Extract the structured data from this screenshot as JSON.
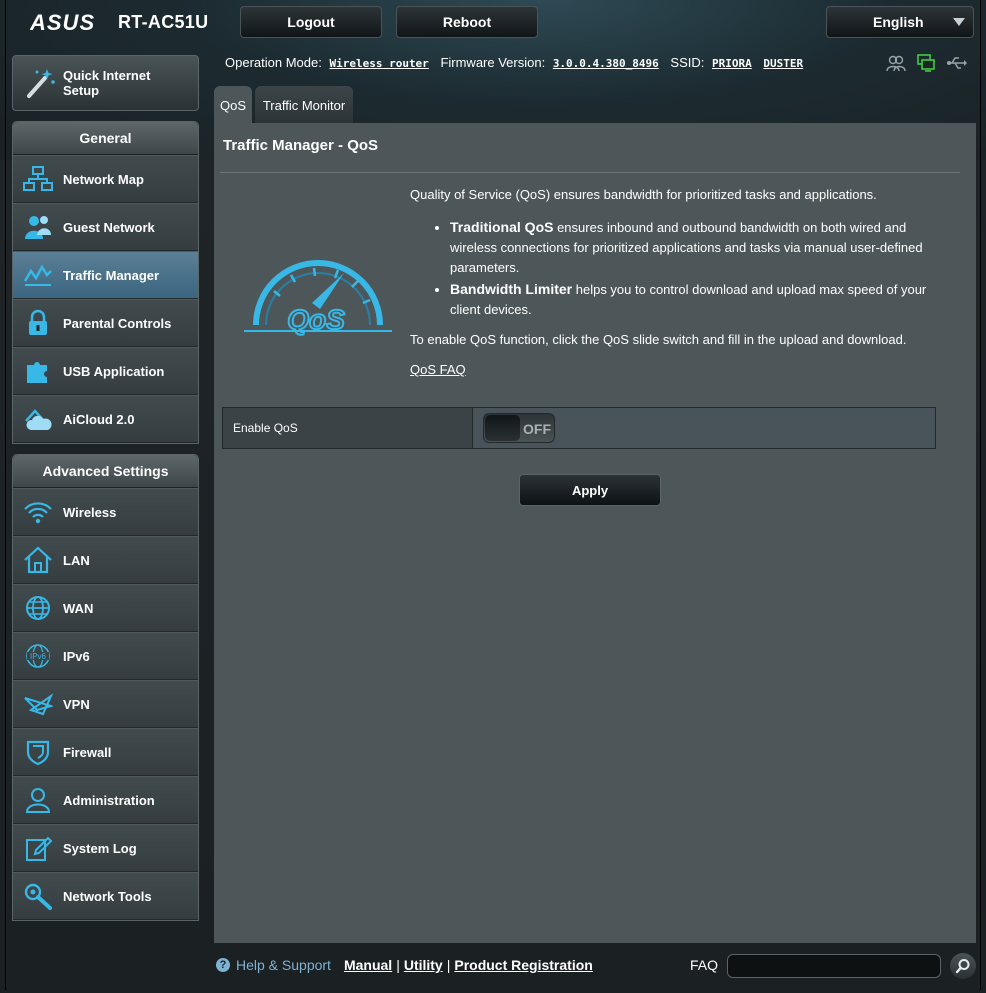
{
  "header": {
    "brand": "ASUS",
    "model": "RT-AC51U",
    "logout_label": "Logout",
    "reboot_label": "Reboot",
    "language": "English"
  },
  "status": {
    "operation_mode_label": "Operation Mode:",
    "operation_mode_value": "Wireless router",
    "firmware_label": "Firmware Version:",
    "firmware_value": "3.0.0.4.380_8496",
    "ssid_label": "SSID:",
    "ssid_1": "PRIORA",
    "ssid_2": "DUSTER",
    "icons": [
      "clients-icon",
      "network-status-icon",
      "usb-icon"
    ]
  },
  "sidebar": {
    "quick_setup_line1": "Quick Internet",
    "quick_setup_line2": "Setup",
    "general_title": "General",
    "general_items": [
      {
        "label": "Network Map",
        "icon": "network-map-icon"
      },
      {
        "label": "Guest Network",
        "icon": "guest-network-icon"
      },
      {
        "label": "Traffic Manager",
        "icon": "traffic-manager-icon",
        "active": true
      },
      {
        "label": "Parental Controls",
        "icon": "lock-icon"
      },
      {
        "label": "USB Application",
        "icon": "puzzle-icon"
      },
      {
        "label": "AiCloud 2.0",
        "icon": "cloud-icon"
      }
    ],
    "advanced_title": "Advanced Settings",
    "advanced_items": [
      {
        "label": "Wireless",
        "icon": "wifi-icon"
      },
      {
        "label": "LAN",
        "icon": "home-icon"
      },
      {
        "label": "WAN",
        "icon": "globe-icon"
      },
      {
        "label": "IPv6",
        "icon": "ipv6-icon"
      },
      {
        "label": "VPN",
        "icon": "vpn-icon"
      },
      {
        "label": "Firewall",
        "icon": "shield-icon"
      },
      {
        "label": "Administration",
        "icon": "user-icon"
      },
      {
        "label": "System Log",
        "icon": "edit-icon"
      },
      {
        "label": "Network Tools",
        "icon": "wrench-icon"
      }
    ]
  },
  "tabs": [
    {
      "label": "QoS",
      "active": true
    },
    {
      "label": "Traffic Monitor",
      "active": false
    }
  ],
  "main": {
    "title": "Traffic Manager - QoS",
    "intro": "Quality of Service (QoS) ensures bandwidth for prioritized tasks and applications.",
    "bullet1_bold": "Traditional QoS",
    "bullet1_text": " ensures inbound and outbound bandwidth on both wired and wireless connections for prioritized applications and tasks via manual user-defined parameters.",
    "bullet2_bold": "Bandwidth Limiter",
    "bullet2_text": " helps you to control download and upload max speed of your client devices.",
    "enable_instructions": "To enable QoS function, click the QoS slide switch and fill in the upload and download.",
    "faq_link": "QoS FAQ",
    "logo_text": "QoS",
    "enable_label": "Enable QoS",
    "toggle_state": "OFF",
    "apply_label": "Apply"
  },
  "footer": {
    "help_label": "Help & Support",
    "manual": "Manual",
    "utility": "Utility",
    "product_registration": "Product Registration",
    "separator": "|",
    "faq_label": "FAQ",
    "faq_value": ""
  },
  "colors": {
    "accent_blue": "#7eb2d3",
    "icon_cyan": "#38b8e6",
    "active_menu": "#4a7390",
    "panel_bg": "#4d5759",
    "status_green": "#3fcc3f"
  }
}
